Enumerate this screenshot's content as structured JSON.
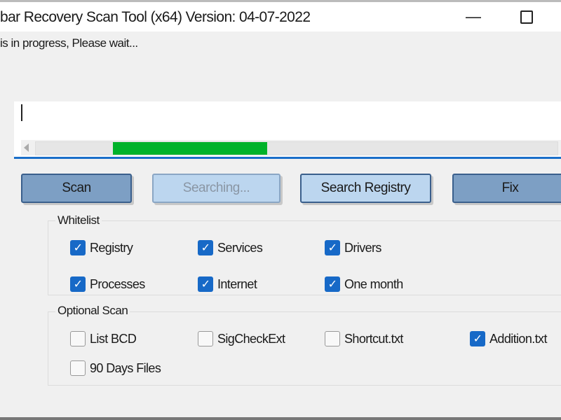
{
  "window": {
    "title": "bar Recovery Scan Tool (x64) Version: 04-07-2022",
    "minimize_icon": "minimize-icon",
    "maximize_icon": "maximize-icon"
  },
  "status_text": "is in progress, Please wait...",
  "progress": {
    "mode": "marquee",
    "color": "#00b22a"
  },
  "buttons": {
    "scan": "Scan",
    "searching": "Searching...",
    "search_registry": "Search Registry",
    "fix": "Fix"
  },
  "whitelist": {
    "title": "Whitelist",
    "items": [
      {
        "label": "Registry",
        "checked": true
      },
      {
        "label": "Services",
        "checked": true
      },
      {
        "label": "Drivers",
        "checked": true
      },
      {
        "label": "Processes",
        "checked": true
      },
      {
        "label": "Internet",
        "checked": true
      },
      {
        "label": "One month",
        "checked": true
      }
    ]
  },
  "optional_scan": {
    "title": "Optional Scan",
    "items": [
      {
        "label": "List BCD",
        "checked": false
      },
      {
        "label": "SigCheckExt",
        "checked": false
      },
      {
        "label": "Shortcut.txt",
        "checked": false
      },
      {
        "label": "Addition.txt",
        "checked": true
      },
      {
        "label": "90 Days Files",
        "checked": false
      }
    ]
  },
  "colors": {
    "accent": "#1769c7",
    "button": "#7d9fc4",
    "progress": "#00b22a"
  }
}
